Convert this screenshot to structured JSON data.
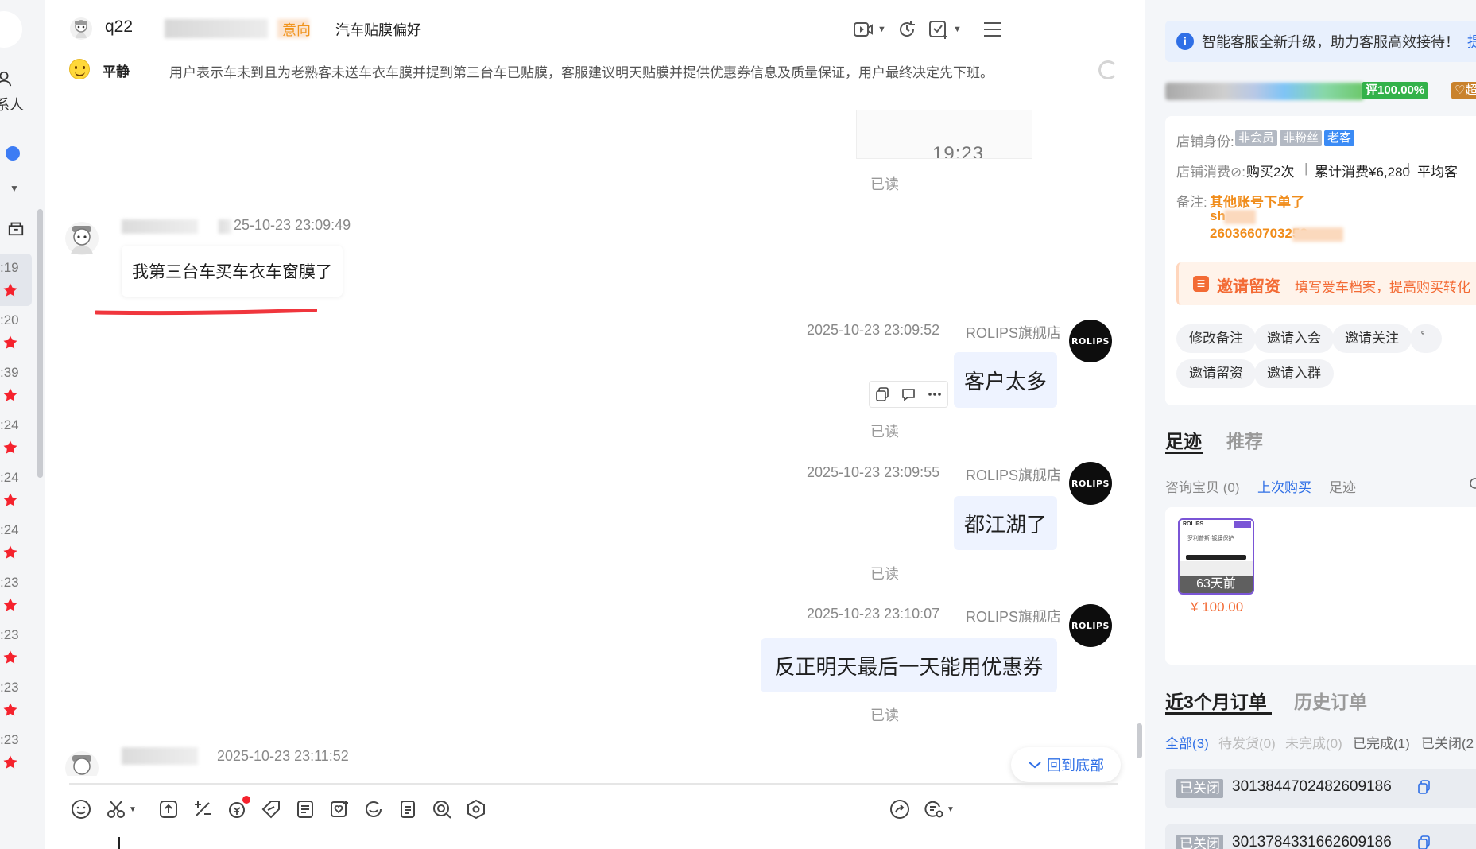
{
  "left": {
    "contacts_label": "系人",
    "conversations": [
      {
        "time": ":19",
        "active": true
      },
      {
        "time": ":20",
        "active": false
      },
      {
        "time": ":39",
        "active": false
      },
      {
        "time": ":24",
        "active": false
      },
      {
        "time": ":24",
        "active": false
      },
      {
        "time": ":24",
        "active": false
      },
      {
        "time": ":23",
        "active": false
      },
      {
        "time": ":23",
        "active": false
      },
      {
        "time": ":23",
        "active": false
      },
      {
        "time": ":23",
        "active": false
      }
    ],
    "colors": {
      "star": "#f5222d",
      "dot": "#3d7cf4"
    }
  },
  "chat": {
    "header": {
      "customer_name": "q22",
      "intent_tag": "意向",
      "preference_tag": "汽车贴膜偏好"
    },
    "summary": {
      "mood": "平静",
      "text": "用户表示车未到且为老熟客未送车衣车膜并提到第三台车已贴膜，客服建议明天贴膜并提供优惠券信息及质量保证，用户最终决定先下班。"
    },
    "image_stub_time": "19:23",
    "read_label": "已读",
    "messages": [
      {
        "side": "left",
        "time": "25-10-23 23:09:49",
        "text": "我第三台车买车衣车窗膜了"
      },
      {
        "side": "right",
        "time": "2025-10-23 23:09:52",
        "store": "ROLIPS旗舰店",
        "text": "客户太多"
      },
      {
        "side": "right",
        "time": "2025-10-23 23:09:55",
        "store": "ROLIPS旗舰店",
        "text": "都江湖了"
      },
      {
        "side": "right",
        "time": "2025-10-23 23:10:07",
        "store": "ROLIPS旗舰店",
        "text": "反正明天最后一天能用优惠券"
      },
      {
        "side": "left",
        "time": "2025-10-23 23:11:52",
        "text": ""
      }
    ],
    "store_avatar_text": "ROLIPS",
    "back_to_bottom": "回到底部",
    "colors": {
      "bubble_right": "#eef3ff",
      "accent": "#2f6fe6",
      "underline": "#f0363d"
    }
  },
  "right": {
    "notice": {
      "text": "智能客服全新升级，助力客服高效接待！",
      "link": "提"
    },
    "rating": {
      "percent": "评100.00%",
      "level": "超级"
    },
    "info": {
      "identity_label": "店铺身份:",
      "identity_tags": [
        "非会员",
        "非粉丝",
        "老客"
      ],
      "spend_label": "店铺消费",
      "spend_items": [
        "购买2次",
        "累计消费¥6,280",
        "平均客"
      ],
      "remark_label": "备注:",
      "remark_lines": [
        "其他账号下单了",
        "sh",
        "2603660703252"
      ]
    },
    "invite": {
      "title": "邀请留资",
      "subtitle": "填写爱车档案，提高购买转化"
    },
    "actions": [
      "修改备注",
      "邀请入会",
      "邀请关注",
      "邀请留资",
      "邀请入群"
    ],
    "footprint_tabs": [
      "足迹",
      "推荐"
    ],
    "footprint_subtabs": [
      "咨询宝贝 (0)",
      "上次购买",
      "足迹"
    ],
    "product": {
      "age": "63天前",
      "price": "¥ 100.00",
      "brand": "ROLIPS",
      "caption": "罗利普斯·镀膜保护"
    },
    "orders_tabs": [
      "近3个月订单",
      "历史订单"
    ],
    "order_filters": [
      "全部(3)",
      "待发货(0)",
      "未完成(0)",
      "已完成(1)",
      "已关闭(2"
    ],
    "orders": [
      {
        "status": "已关闭",
        "id": "3013844702482609186"
      },
      {
        "status": "已关闭",
        "id": "3013784331662609186"
      }
    ]
  }
}
